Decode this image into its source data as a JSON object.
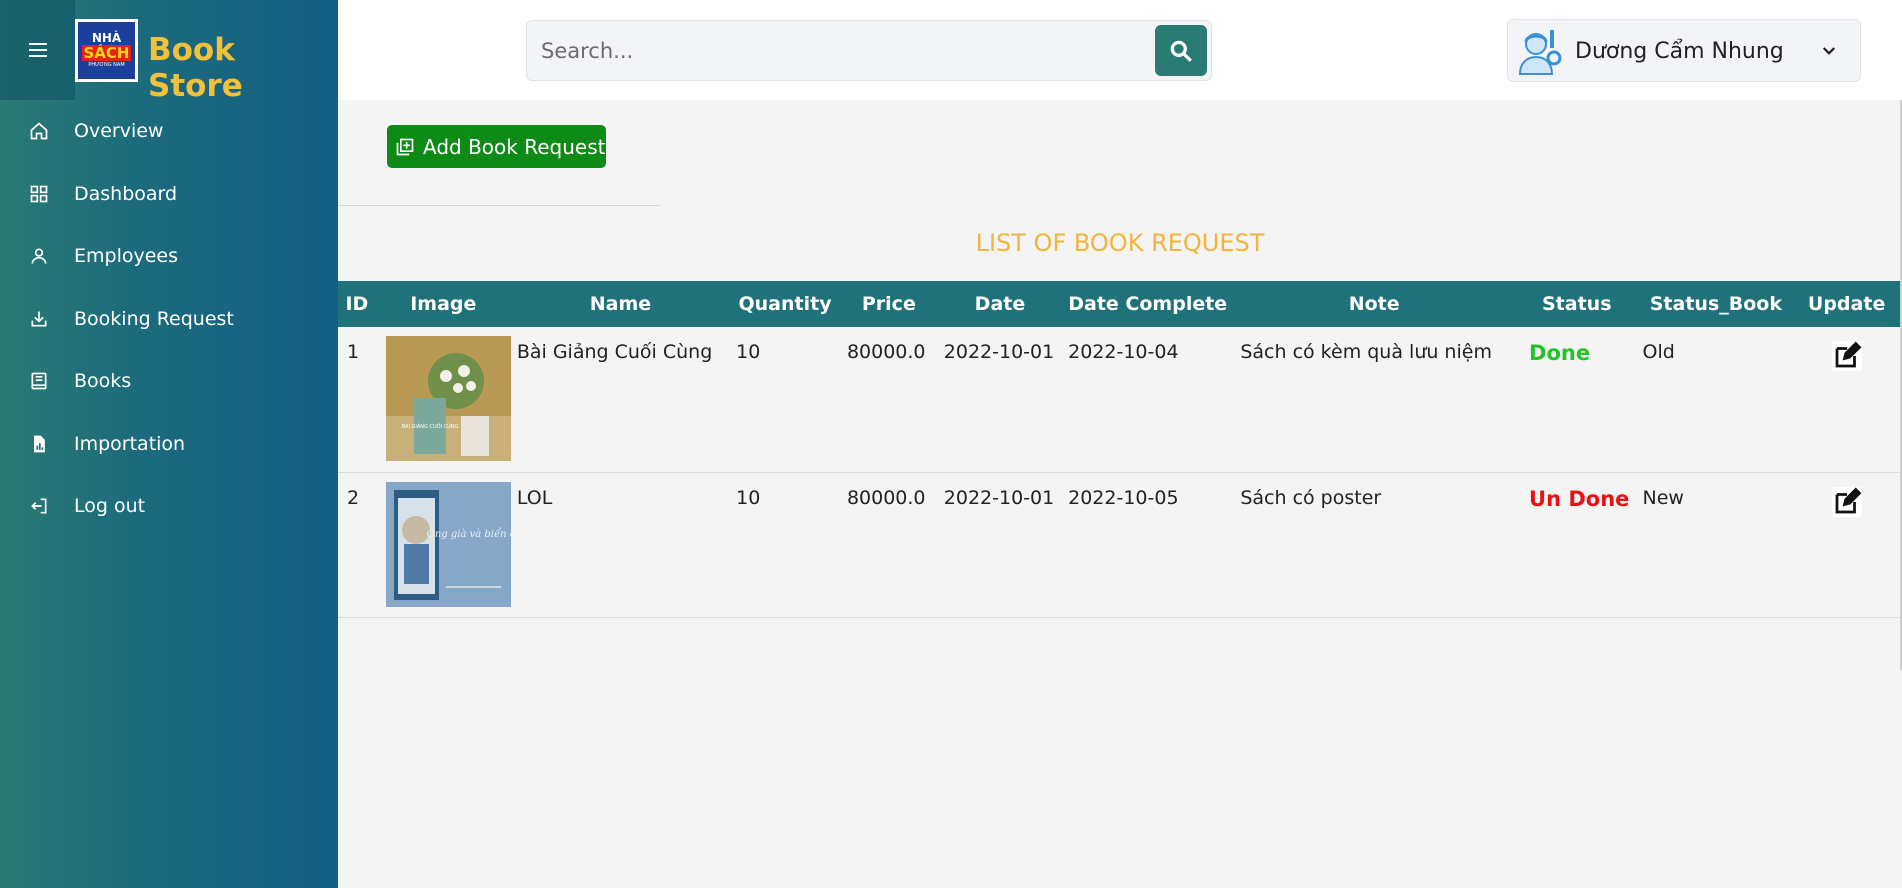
{
  "sidebar": {
    "brand": "Book Store",
    "logo": {
      "line1": "NHÀ",
      "line2": "SÁCH",
      "line3": "PHƯƠNG NAM"
    },
    "items": [
      {
        "label": "Overview",
        "icon": "home-icon"
      },
      {
        "label": "Dashboard",
        "icon": "grid-icon"
      },
      {
        "label": "Employees",
        "icon": "user-icon"
      },
      {
        "label": "Booking Request",
        "icon": "download-icon"
      },
      {
        "label": "Books",
        "icon": "book-icon"
      },
      {
        "label": "Importation",
        "icon": "file-chart-icon"
      },
      {
        "label": "Log out",
        "icon": "logout-icon"
      }
    ]
  },
  "header": {
    "search_placeholder": "Search...",
    "user_name": "Dương Cẩm Nhung"
  },
  "main": {
    "add_button": "Add Book Request",
    "title": "LIST OF BOOK REQUEST",
    "columns": [
      "ID",
      "Image",
      "Name",
      "Quantity",
      "Price",
      "Date",
      "Date Complete",
      "Note",
      "Status",
      "Status_Book",
      "Update"
    ],
    "rows": [
      {
        "id": "1",
        "name": "Bài Giảng Cuối Cùng",
        "quantity": "10",
        "price": "80000.0",
        "date": "2022-10-01",
        "date_complete": "2022-10-04",
        "note": "Sách có kèm quà lưu niệm",
        "status": "Done",
        "status_book": "Old",
        "cover_text": "BÀI GIẢNG CUỐI CÙNG"
      },
      {
        "id": "2",
        "name": "LOL",
        "quantity": "10",
        "price": "80000.0",
        "date": "2022-10-01",
        "date_complete": "2022-10-05",
        "note": "Sách có poster",
        "status": "Un Done",
        "status_book": "New",
        "cover_text": "Ông già và biển cả"
      }
    ]
  },
  "colors": {
    "sidebar": "#1c6b7d",
    "brand": "#f3c03a",
    "header_row": "#1f727a",
    "done": "#23c427",
    "undone": "#e81212",
    "add_button": "#0e8a17"
  }
}
